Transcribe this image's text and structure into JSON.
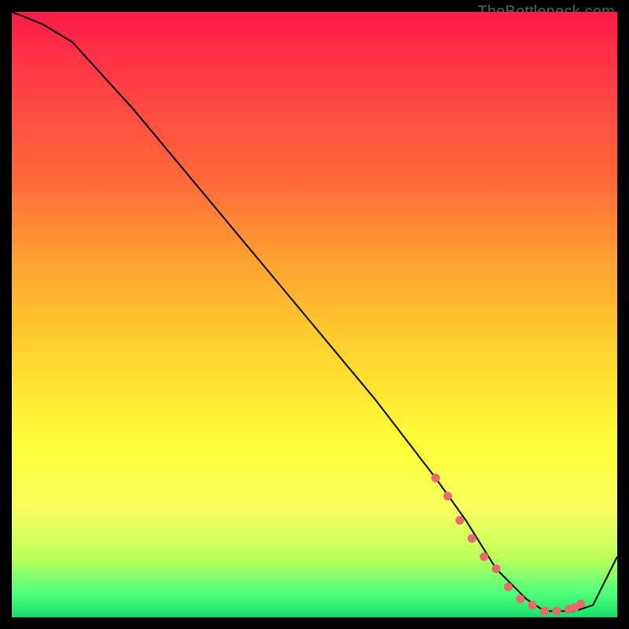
{
  "watermark": "TheBottleneck.com",
  "colors": {
    "curve_stroke": "#000000",
    "dot_fill": "#e86a6f",
    "gradient_top": "#ff1a47",
    "gradient_bottom": "#18e06a"
  },
  "chart_data": {
    "type": "line",
    "title": "",
    "xlabel": "",
    "ylabel": "",
    "xlim": [
      0,
      100
    ],
    "ylim": [
      0,
      100
    ],
    "x": [
      0,
      5,
      10,
      20,
      30,
      40,
      50,
      60,
      70,
      75,
      80,
      85,
      88,
      90,
      93,
      96,
      100
    ],
    "values": [
      100,
      98,
      95,
      84,
      72,
      60,
      48,
      36,
      23,
      16,
      8,
      3,
      1,
      1,
      1,
      2,
      10
    ],
    "annotations": {
      "dot_x": [
        70,
        72,
        74,
        76,
        78,
        80,
        82,
        84,
        86,
        88,
        90,
        92,
        93,
        94
      ],
      "dot_y": [
        23,
        20,
        16,
        13,
        10,
        8,
        5,
        3,
        2,
        1,
        1,
        1.3,
        1.6,
        2.2
      ]
    }
  }
}
